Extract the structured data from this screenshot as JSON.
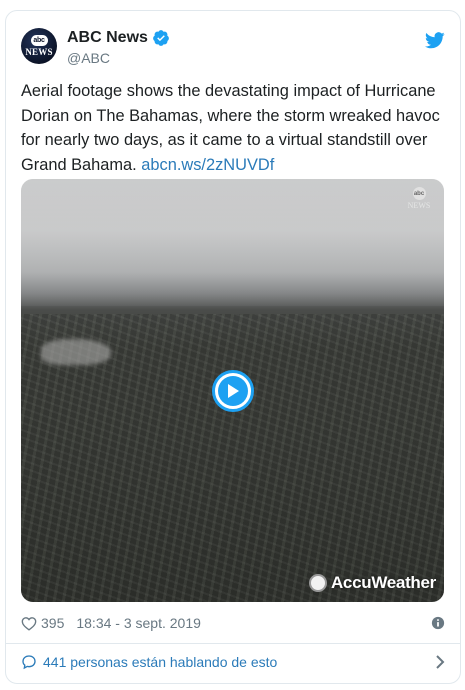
{
  "tweet": {
    "display_name": "ABC News",
    "handle": "@ABC",
    "avatar": {
      "top_text": "abc",
      "bottom_text": "NEWS"
    },
    "text": "Aerial footage shows the devastating impact of Hurricane Dorian on The Bahamas, where the storm wreaked havoc for nearly two days, as it came to a virtual standstill over Grand Bahama.",
    "link_text": "abcn.ws/2zNUVDf",
    "media": {
      "type": "video",
      "watermark": "AccuWeather",
      "corner_bug": {
        "top_text": "abc",
        "bottom_text": "NEWS"
      }
    },
    "likes": "395",
    "timestamp": "18:34 - 3 sept. 2019",
    "conversation_text": "441 personas están hablando de esto"
  },
  "colors": {
    "twitter_blue": "#1da1f2",
    "link_blue": "#2b7bb9",
    "text": "#1c2022",
    "muted": "#697882",
    "border": "#e1e8ed"
  },
  "icons": [
    "verified-badge-icon",
    "twitter-bird-icon",
    "play-icon",
    "heart-icon",
    "info-icon",
    "speech-bubble-icon",
    "chevron-right-icon"
  ]
}
